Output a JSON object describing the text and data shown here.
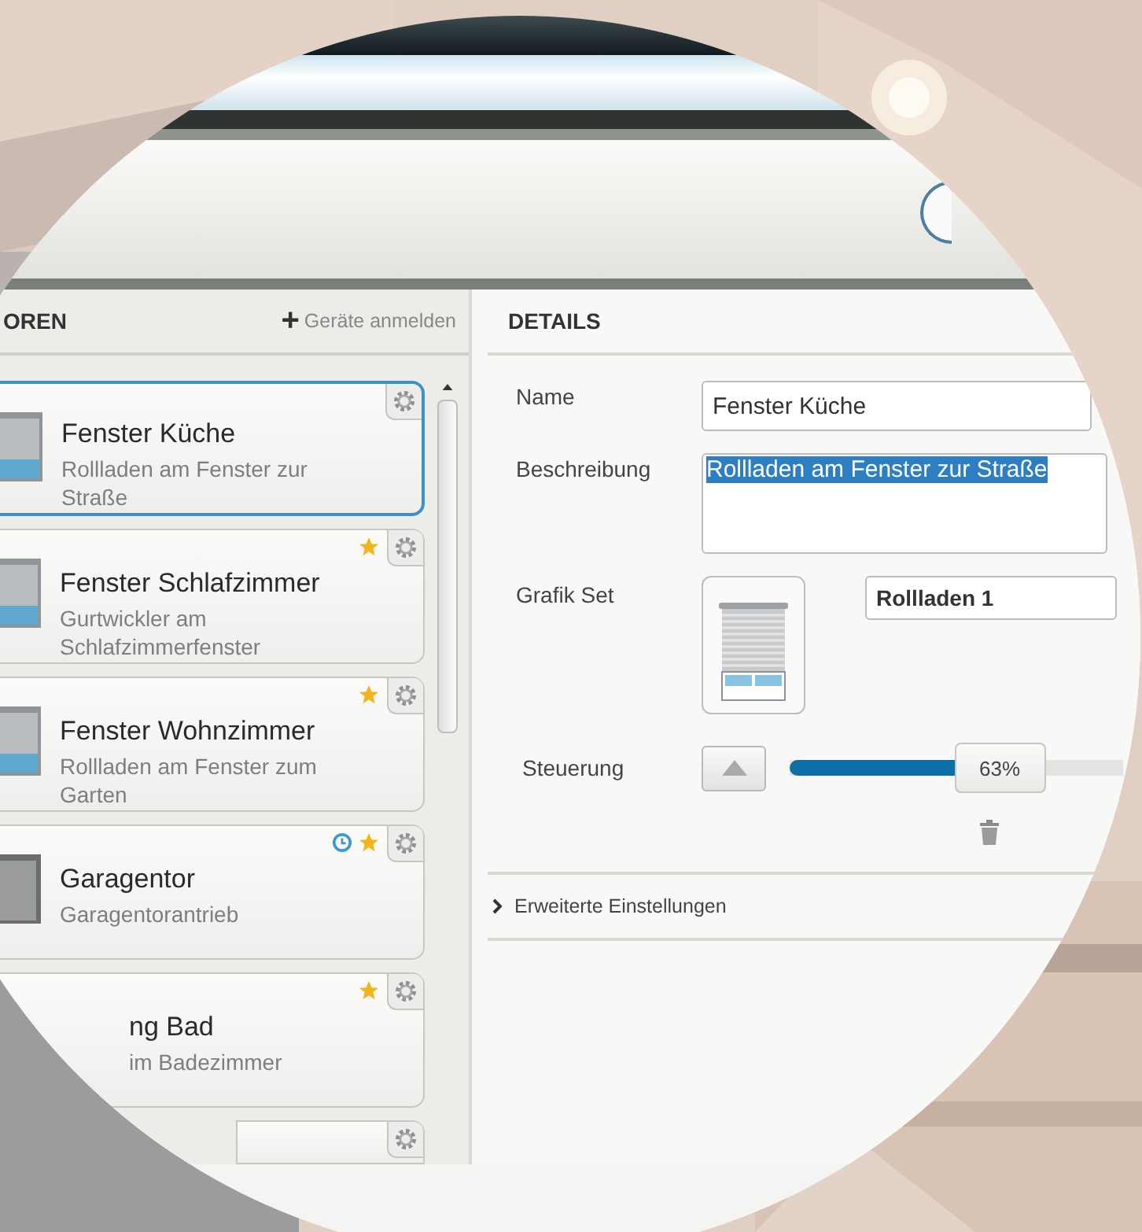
{
  "sidebar": {
    "heading": "OREN",
    "add_link": {
      "icon": "+",
      "label": "Geräte anmelden"
    },
    "items": [
      {
        "title": "Fenster Küche",
        "subtitle": "Rollladen am Fenster zur Straße",
        "selected": true,
        "starred": false,
        "timer": false,
        "kind": "shutter"
      },
      {
        "title": "Fenster Schlafzimmer",
        "subtitle": "Gurtwickler am Schlafzimmerfenster",
        "selected": false,
        "starred": true,
        "timer": false,
        "kind": "shutter"
      },
      {
        "title": "Fenster Wohnzimmer",
        "subtitle": "Rollladen am Fenster zum Garten",
        "selected": false,
        "starred": true,
        "timer": false,
        "kind": "shutter"
      },
      {
        "title": "Garagentor",
        "subtitle": "Garagentorantrieb",
        "selected": false,
        "starred": true,
        "timer": true,
        "kind": "garage"
      },
      {
        "title": "ng Bad",
        "subtitle": "im Badezimmer",
        "selected": false,
        "starred": true,
        "timer": false
      }
    ]
  },
  "details": {
    "heading": "DETAILS",
    "name": {
      "label": "Name",
      "value": "Fenster Küche"
    },
    "description": {
      "label": "Beschreibung",
      "value": "Rollladen am Fenster zur Straße",
      "selected": true
    },
    "graphic_set": {
      "label": "Grafik Set",
      "value": "Rollladen 1"
    },
    "control": {
      "label": "Steuerung",
      "level": 0.63,
      "reading": "63%"
    },
    "advanced": {
      "label": "Erweiterte Einstellungen",
      "expanded": false
    }
  }
}
